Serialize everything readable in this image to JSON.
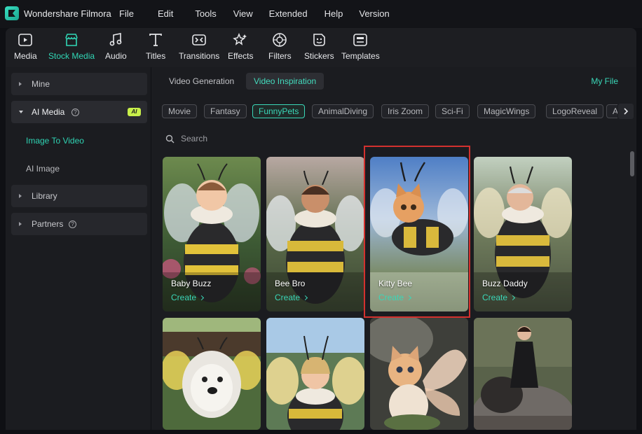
{
  "app": {
    "name": "Wondershare Filmora"
  },
  "menu": [
    "File",
    "Edit",
    "Tools",
    "View",
    "Extended",
    "Help",
    "Version"
  ],
  "toolbar": {
    "items": [
      {
        "label": "Media",
        "icon": "media-icon"
      },
      {
        "label": "Stock Media",
        "icon": "stock-media-icon"
      },
      {
        "label": "Audio",
        "icon": "audio-icon"
      },
      {
        "label": "Titles",
        "icon": "titles-icon"
      },
      {
        "label": "Transitions",
        "icon": "transitions-icon"
      },
      {
        "label": "Effects",
        "icon": "effects-icon"
      },
      {
        "label": "Filters",
        "icon": "filters-icon"
      },
      {
        "label": "Stickers",
        "icon": "stickers-icon"
      },
      {
        "label": "Templates",
        "icon": "templates-icon"
      }
    ],
    "active": "Stock Media",
    "accent": "#31d7b6"
  },
  "sidebar": {
    "mine": "Mine",
    "ai_media": "AI Media",
    "ai_badge": "AI",
    "ai_sub": [
      "Image To Video",
      "AI Image"
    ],
    "active_sub": "Image To Video",
    "library": "Library",
    "partners": "Partners",
    "help_glyph": "?"
  },
  "main": {
    "tabs": [
      "Video Generation",
      "Video Inspiration"
    ],
    "active_tab": "Video Inspiration",
    "my_file": "My File",
    "chips": [
      "Movie",
      "Fantasy",
      "FunnyPets",
      "AnimalDiving",
      "Iris Zoom",
      "Sci-Fi",
      "MagicWings",
      "LogoReveal",
      "AI"
    ],
    "active_chip": "FunnyPets",
    "search_placeholder": "Search",
    "create_label": "Create",
    "cards": [
      {
        "title": "Baby Buzz",
        "subject": "baby in bee costume"
      },
      {
        "title": "Bee Bro",
        "subject": "young man in bee costume"
      },
      {
        "title": "Kitty Bee",
        "subject": "kitten in bee costume",
        "highlighted": true
      },
      {
        "title": "Buzz Daddy",
        "subject": "older man in bee costume"
      },
      {
        "title": "",
        "subject": "dog with bee antennae and wings"
      },
      {
        "title": "",
        "subject": "woman in bee costume"
      },
      {
        "title": "",
        "subject": "kitten with fairy wings"
      },
      {
        "title": "",
        "subject": "woman on elephant"
      }
    ]
  }
}
